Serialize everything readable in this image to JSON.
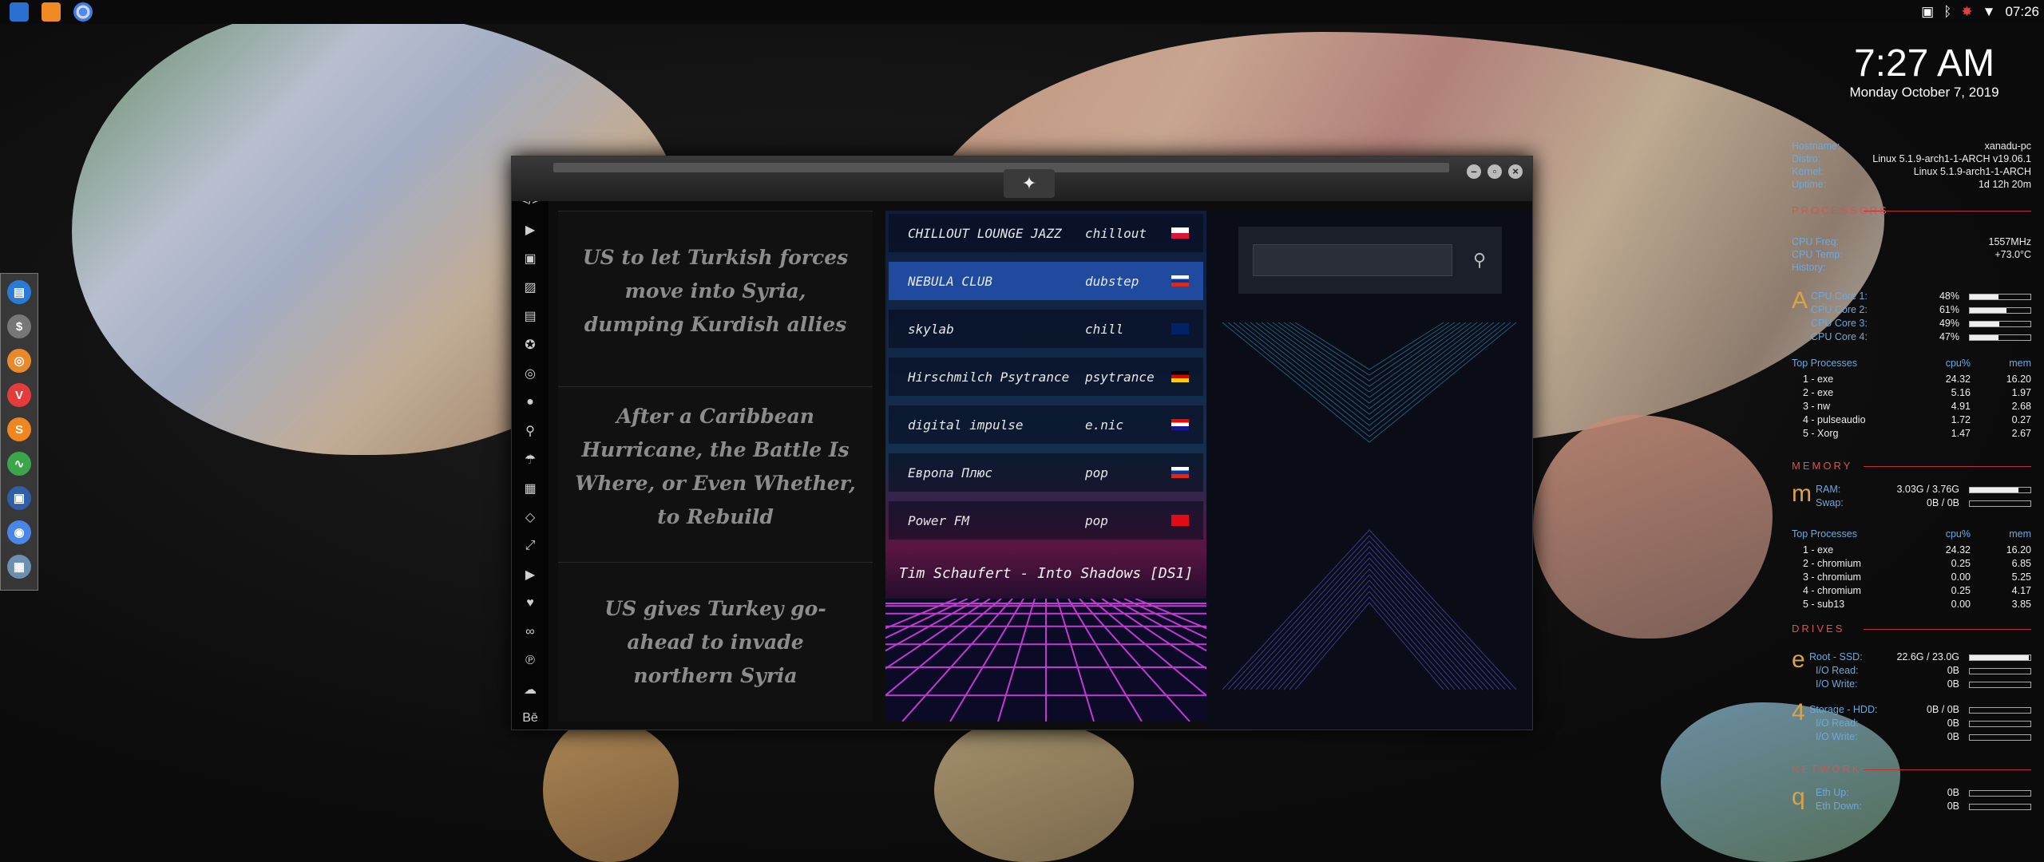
{
  "desktop": {
    "time": "7:27 AM",
    "date": "Monday October  7, 2019",
    "topbar_clock": "07:26"
  },
  "colors": {
    "accent": "#1f4a9e",
    "conky_header": "#e05050",
    "conky_label": "#6fa8dc",
    "conky_glyph": "#d9a34a"
  },
  "topbar_launchers": [
    "files-icon",
    "sublime-icon",
    "chromium-icon"
  ],
  "tray_icons": [
    "image-icon",
    "bluetooth-icon",
    "warning-icon",
    "wifi-icon"
  ],
  "dock": {
    "items": [
      "app-store-icon",
      "dollar-icon",
      "ubuntu-icon",
      "vivaldi-icon",
      "s-app-icon",
      "heartbeat-icon",
      "terminal-screen-icon",
      "chrome-icon",
      "grid-icon"
    ]
  },
  "app": {
    "sidebar_icons": [
      ">_",
      "</>",
      "▶",
      "▣",
      "▨",
      "▤",
      "✪",
      "◎",
      "●",
      "⚲",
      "☂",
      "▦",
      "◇",
      "⤢",
      "▶",
      "♥",
      "∞",
      "℗",
      "☁",
      "Bē"
    ],
    "news": [
      "US to let Turkish forces move into Syria, dumping Kurdish allies",
      "After a Caribbean Hurricane, the Battle Is Where, or Even Whether, to Rebuild",
      "US gives Turkey go-ahead to invade northern Syria"
    ],
    "stations": [
      {
        "name": "CHILLOUT LOUNGE JAZZ",
        "genre": "chillout",
        "flag": "pl",
        "active": false
      },
      {
        "name": "NEBULA CLUB",
        "genre": "dubstep",
        "flag": "ru",
        "active": true
      },
      {
        "name": "skylab",
        "genre": "chill",
        "flag": "gb",
        "active": false
      },
      {
        "name": "Hirschmilch Psytrance",
        "genre": "psytrance",
        "flag": "de",
        "active": false
      },
      {
        "name": "digital impulse",
        "genre": "e.nic",
        "flag": "hr",
        "active": false
      },
      {
        "name": "Европа Плюс",
        "genre": "pop",
        "flag": "ru",
        "active": false
      },
      {
        "name": "Power FM",
        "genre": "pop",
        "flag": "tr",
        "active": false
      }
    ],
    "now_playing": "Tim Schaufert - Into Shadows [DS1]",
    "search": {
      "value": "",
      "placeholder": ""
    }
  },
  "conky": {
    "system": [
      {
        "label": "Hostname:",
        "value": "xanadu-pc"
      },
      {
        "label": "Distro:",
        "value": "Linux 5.1.9-arch1-1-ARCH v19.06.1"
      },
      {
        "label": "Kernel:",
        "value": "Linux 5.1.9-arch1-1-ARCH"
      },
      {
        "label": "Uptime:",
        "value": "1d 12h 20m"
      }
    ],
    "processors": {
      "title": "PROCESSORS",
      "glyph": "A",
      "freq_label": "CPU Freq:",
      "freq": "1557MHz",
      "temp_label": "CPU Temp:",
      "temp": "+73.0°C",
      "history_label": "History:",
      "cores": [
        {
          "label": "CPU Core 1:",
          "value": "48%",
          "fill": 0.48
        },
        {
          "label": "CPU Core 2:",
          "value": "61%",
          "fill": 0.61
        },
        {
          "label": "CPU Core 3:",
          "value": "49%",
          "fill": 0.49
        },
        {
          "label": "CPU Core 4:",
          "value": "47%",
          "fill": 0.47
        }
      ],
      "top_label": "Top Processes",
      "col_cpu": "cpu%",
      "col_mem": "mem",
      "procs": [
        {
          "n": "1 - exe",
          "cpu": "24.32",
          "mem": "16.20"
        },
        {
          "n": "2 - exe",
          "cpu": "5.16",
          "mem": "1.97"
        },
        {
          "n": "3 - nw",
          "cpu": "4.91",
          "mem": "2.68"
        },
        {
          "n": "4 - pulseaudio",
          "cpu": "1.72",
          "mem": "0.27"
        },
        {
          "n": "5 - Xorg",
          "cpu": "1.47",
          "mem": "2.67"
        }
      ]
    },
    "memory": {
      "title": "MEMORY",
      "glyph": "m",
      "ram_label": "RAM:",
      "ram": "3.03G / 3.76G",
      "ram_fill": 0.8,
      "swap_label": "Swap:",
      "swap": "0B / 0B",
      "swap_fill": 0,
      "top_label": "Top Processes",
      "col_cpu": "cpu%",
      "col_mem": "mem",
      "procs": [
        {
          "n": "1 - exe",
          "cpu": "24.32",
          "mem": "16.20"
        },
        {
          "n": "2 - chromium",
          "cpu": "0.25",
          "mem": "6.85"
        },
        {
          "n": "3 - chromium",
          "cpu": "0.00",
          "mem": "5.25"
        },
        {
          "n": "4 - chromium",
          "cpu": "0.25",
          "mem": "4.17"
        },
        {
          "n": "5 - sub13",
          "cpu": "0.00",
          "mem": "3.85"
        }
      ]
    },
    "drives": {
      "title": "DRIVES",
      "glyph_root": "e",
      "root_label": "Root - SSD:",
      "root": "22.6G / 23.0G",
      "root_fill": 0.98,
      "root_read_label": "I/O Read:",
      "root_read": "0B",
      "root_write_label": "I/O Write:",
      "root_write": "0B",
      "glyph_storage": "4",
      "storage_label": "Storage - HDD:",
      "storage": "0B / 0B",
      "storage_read_label": "I/O Read:",
      "storage_read": "0B",
      "storage_write_label": "I/O Write:",
      "storage_write": "0B"
    },
    "network": {
      "title": "NETWORK",
      "glyph": "q",
      "up_label": "Eth Up:",
      "up": "0B",
      "down_label": "Eth Down:",
      "down": "0B"
    }
  }
}
